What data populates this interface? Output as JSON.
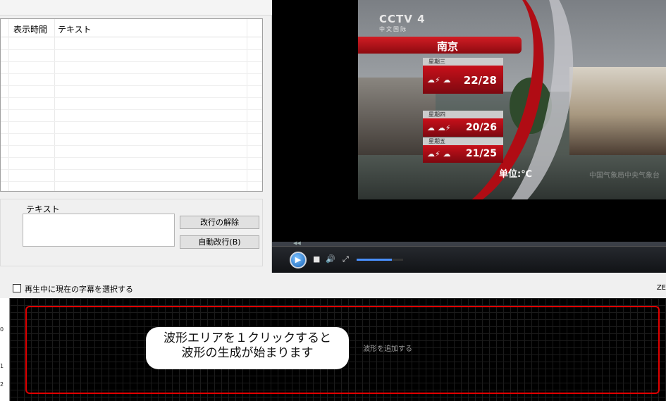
{
  "subtitle_grid": {
    "col_time": "表示時間",
    "col_text": "テキスト"
  },
  "editor": {
    "text_label": "テキスト",
    "text_value": "",
    "unwrap_button": "改行の解除",
    "autowrap_button": "自動改行(B)"
  },
  "video": {
    "channel": "CCTV 4",
    "channel_sub": "中文国际",
    "city": "南京",
    "days": [
      {
        "label": "星期三",
        "temps": "22/28"
      },
      {
        "label": "星期四",
        "temps": "20/26"
      },
      {
        "label": "星期五",
        "temps": "21/25"
      }
    ],
    "unit": "单位:℃",
    "watermark": "中国气象局中央气象台"
  },
  "player": {
    "volume": 0.75,
    "icons": [
      "play-icon",
      "stop-icon",
      "volume-icon",
      "fullscreen-icon"
    ]
  },
  "bottom": {
    "select_current_label": "再生中に現在の字幕を選択する",
    "zoom_label": "ZE",
    "hint_line1": "波形エリアを１クリックすると",
    "hint_line2": "波形の生成が始まります",
    "add_waveform": "波形を追加する",
    "ruler": [
      "0",
      "1",
      "2"
    ]
  }
}
